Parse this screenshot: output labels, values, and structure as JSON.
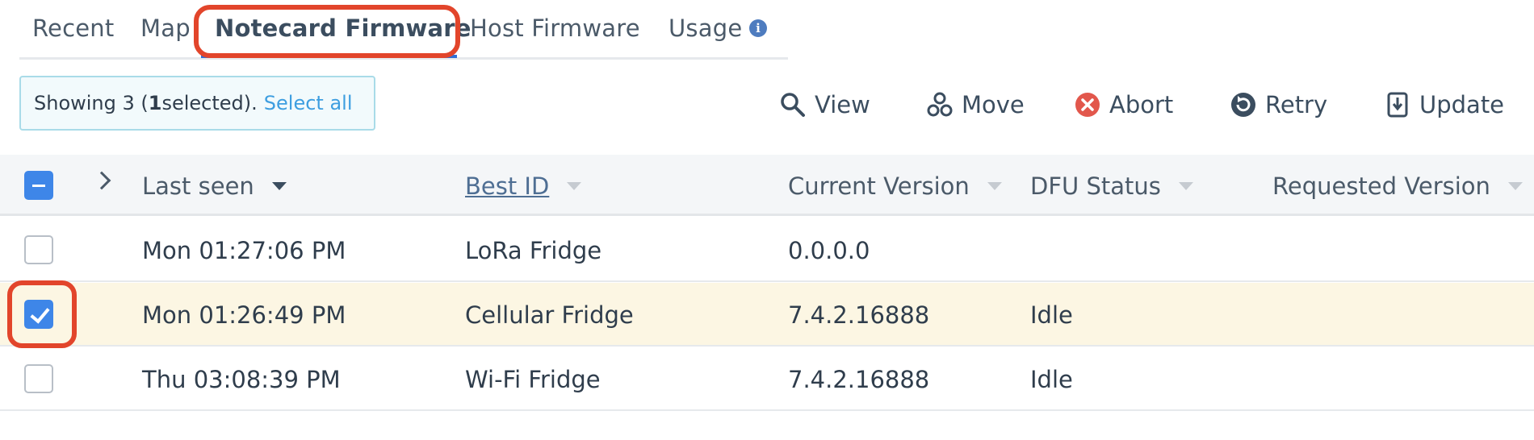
{
  "tabs": [
    {
      "label": "Recent"
    },
    {
      "label": "Map"
    },
    {
      "label": "Notecard Firmware",
      "active": true
    },
    {
      "label": "Host Firmware"
    },
    {
      "label": "Usage"
    }
  ],
  "selection": {
    "prefix": "Showing 3 (",
    "count": "1",
    "suffix": " selected).",
    "select_all": "Select all"
  },
  "actions": [
    {
      "label": "View",
      "icon": "search-icon"
    },
    {
      "label": "Move",
      "icon": "move-icon"
    },
    {
      "label": "Abort",
      "icon": "abort-icon"
    },
    {
      "label": "Retry",
      "icon": "retry-icon"
    },
    {
      "label": "Update",
      "icon": "update-icon"
    }
  ],
  "table": {
    "columns": [
      "Last seen",
      "Best ID",
      "Current Version",
      "DFU Status",
      "Requested Version"
    ],
    "rows": [
      {
        "checked": false,
        "last_seen": "Mon 01:27:06 PM",
        "best_id": "LoRa Fridge",
        "current_version": "0.0.0.0",
        "dfu_status": "",
        "requested_version": ""
      },
      {
        "checked": true,
        "last_seen": "Mon 01:26:49 PM",
        "best_id": "Cellular Fridge",
        "current_version": "7.4.2.16888",
        "dfu_status": "Idle",
        "requested_version": ""
      },
      {
        "checked": false,
        "last_seen": "Thu 03:08:39 PM",
        "best_id": "Wi-Fi Fridge",
        "current_version": "7.4.2.16888",
        "dfu_status": "Idle",
        "requested_version": ""
      }
    ]
  },
  "colors": {
    "accent": "#3e86e8",
    "highlight": "#e2452b",
    "selected_row": "#fcf6e3",
    "link": "#3d9ee0"
  }
}
